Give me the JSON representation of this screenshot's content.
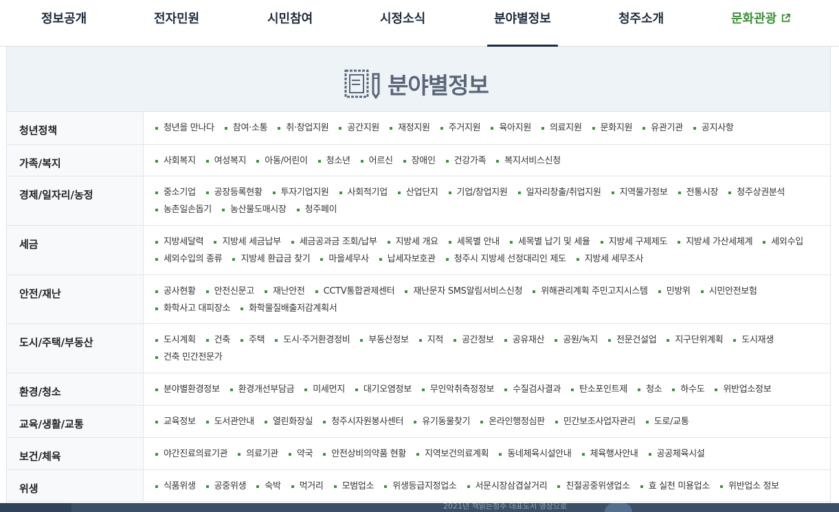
{
  "nav": {
    "items": [
      {
        "label": "정보공개"
      },
      {
        "label": "전자민원"
      },
      {
        "label": "시민참여"
      },
      {
        "label": "시정소식"
      },
      {
        "label": "분야별정보"
      },
      {
        "label": "청주소개"
      },
      {
        "label": "문화관광"
      }
    ],
    "active": "분야별정보"
  },
  "page": {
    "title": "분야별정보"
  },
  "categories": [
    {
      "name": "청년정책",
      "links": [
        "청년을 만나다",
        "참여·소통",
        "취·창업지원",
        "공간지원",
        "재정지원",
        "주거지원",
        "육아지원",
        "의료지원",
        "문화지원",
        "유관기관",
        "공지사항"
      ]
    },
    {
      "name": "가족/복지",
      "links": [
        "사회복지",
        "여성복지",
        "아동/어린이",
        "청소년",
        "어르신",
        "장애인",
        "건강가족",
        "복지서비스신청"
      ]
    },
    {
      "name": "경제/일자리/농정",
      "links": [
        "중소기업",
        "공장등록현황",
        "투자기업지원",
        "사회적기업",
        "산업단지",
        "기업/창업지원",
        "일자리창출/취업지원",
        "지역물가정보",
        "전통시장",
        "청주상권분석",
        "농촌일손돕기",
        "농산물도매시장",
        "청주페이"
      ]
    },
    {
      "name": "세금",
      "links": [
        "지방세달력",
        "지방세 세금납부",
        "세금공과금 조회/납부",
        "지방세 개요",
        "세목별 안내",
        "세목별 납기 및 세율",
        "지방세 구제제도",
        "지방세 가산세체계",
        "세외수입",
        "세외수입의 종류",
        "지방세 환급금 찾기",
        "마을세무사",
        "납세자보호관",
        "청주시 지방세 선정대리인 제도",
        "지방세 세무조사"
      ]
    },
    {
      "name": "안전/재난",
      "links": [
        "공사현황",
        "안전신문고",
        "재난안전",
        "CCTV통합관제센터",
        "재난문자 SMS알림서비스신청",
        "위해관리계획 주민고지시스템",
        "민방위",
        "시민안전보험",
        "화학사고 대피장소",
        "화학물질배출저감계획서"
      ]
    },
    {
      "name": "도시/주택/부동산",
      "links": [
        "도시계획",
        "건축",
        "주택",
        "도시·주거환경정비",
        "부동산정보",
        "지적",
        "공간정보",
        "공유재산",
        "공원/녹지",
        "전문건설업",
        "지구단위계획",
        "도시재생",
        "건축 민간전문가"
      ]
    },
    {
      "name": "환경/청소",
      "links": [
        "분야별환경정보",
        "환경개선부담금",
        "미세먼지",
        "대기오염정보",
        "무인악취측정정보",
        "수질검사결과",
        "탄소포인트제",
        "청소",
        "하수도",
        "위반업소정보"
      ]
    },
    {
      "name": "교육/생활/교통",
      "links": [
        "교육정보",
        "도서관안내",
        "열린화장실",
        "청주시자원봉사센터",
        "유기동물찾기",
        "온라인행정심판",
        "민간보조사업자관리",
        "도로/교통"
      ]
    },
    {
      "name": "보건/체육",
      "links": [
        "야간진료의료기관",
        "의료기관",
        "약국",
        "안전상비의약품 현황",
        "지역보건의료계획",
        "동네체육시설안내",
        "체육행사안내",
        "공공체육시설"
      ]
    },
    {
      "name": "위생",
      "links": [
        "식품위생",
        "공중위생",
        "숙박",
        "먹거리",
        "모범업소",
        "위생등급지정업소",
        "서문시장삼겹살거리",
        "친절공중위생업소",
        "효 실천 미용업소",
        "위반업소 정보"
      ]
    }
  ],
  "footer_banner": {
    "text": "2021년 책읽는청주 대표도서 영상으로"
  }
}
